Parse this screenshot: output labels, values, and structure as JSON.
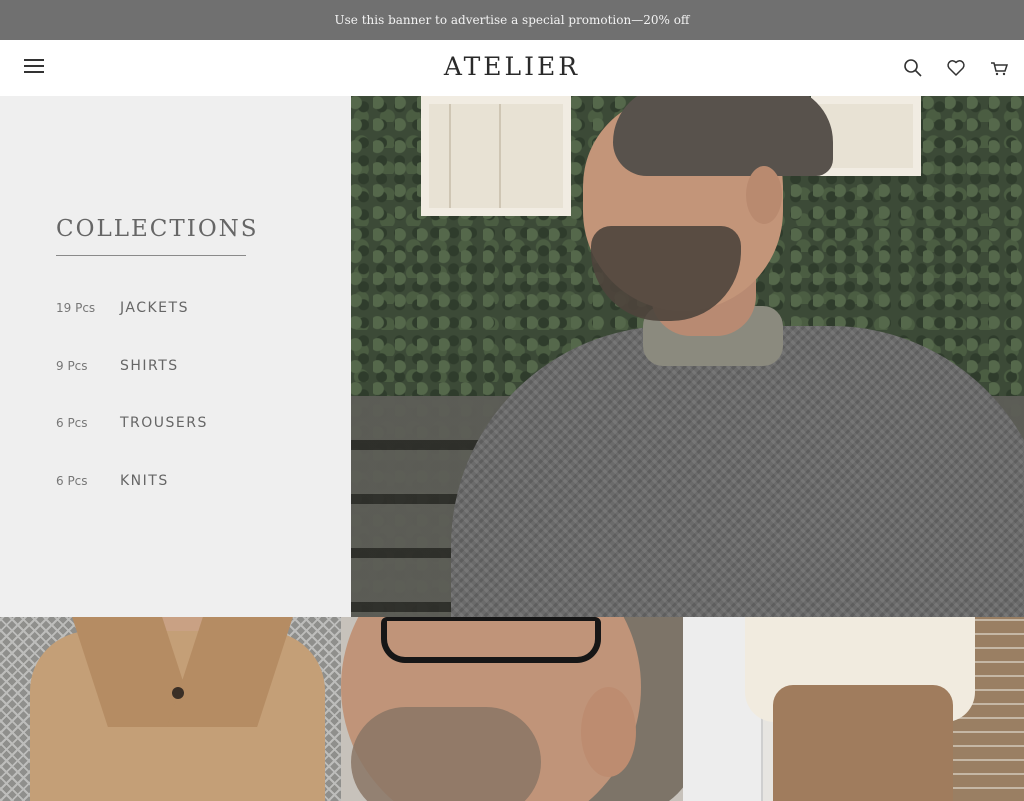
{
  "promo": {
    "text": "Use this banner to advertise a special promotion—20% off"
  },
  "header": {
    "logo": "ATELIER",
    "icons": {
      "menu": "menu-icon",
      "search": "search-icon",
      "wishlist": "heart-icon",
      "cart": "cart-icon"
    }
  },
  "collections": {
    "title": "COLLECTIONS",
    "items": [
      {
        "count": "19 Pcs",
        "name": "JACKETS"
      },
      {
        "count": "9 Pcs",
        "name": "SHIRTS"
      },
      {
        "count": "6 Pcs",
        "name": "TROUSERS"
      },
      {
        "count": "6 Pcs",
        "name": "KNITS"
      }
    ]
  },
  "colors": {
    "promo_bg": "#707070",
    "panel_bg": "#efefef",
    "text": "#666666"
  }
}
